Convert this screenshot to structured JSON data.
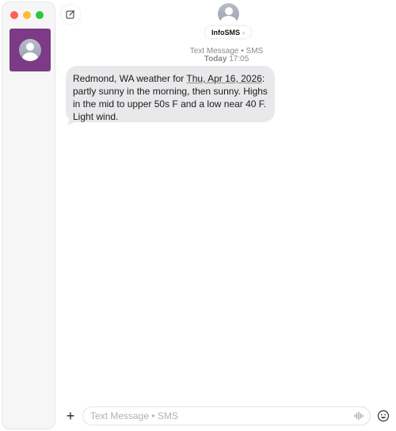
{
  "sidebar": {
    "conversations": [
      {
        "avatar_icon": "person-avatar-icon",
        "selected": true,
        "color": "#7d3a86"
      }
    ]
  },
  "header": {
    "contact_name": "InfoSMS",
    "chevron": "›"
  },
  "thread": {
    "service_label": "Text Message • SMS",
    "timestamp_label": "Today",
    "timestamp_time": "17:05",
    "message": {
      "text_before": "Redmond, WA weather for ",
      "date_link": "Thu, Apr 16, 2026",
      "text_after": ": partly sunny in the morning, then sunny. Highs in the mid to upper 50s F and a low near 40 F. Light wind."
    }
  },
  "composer": {
    "placeholder": "Text Message • SMS",
    "value": "",
    "plus_label": "+"
  },
  "colors": {
    "bubble": "#e9e9eb",
    "selected_conversation": "#7d3a86"
  }
}
